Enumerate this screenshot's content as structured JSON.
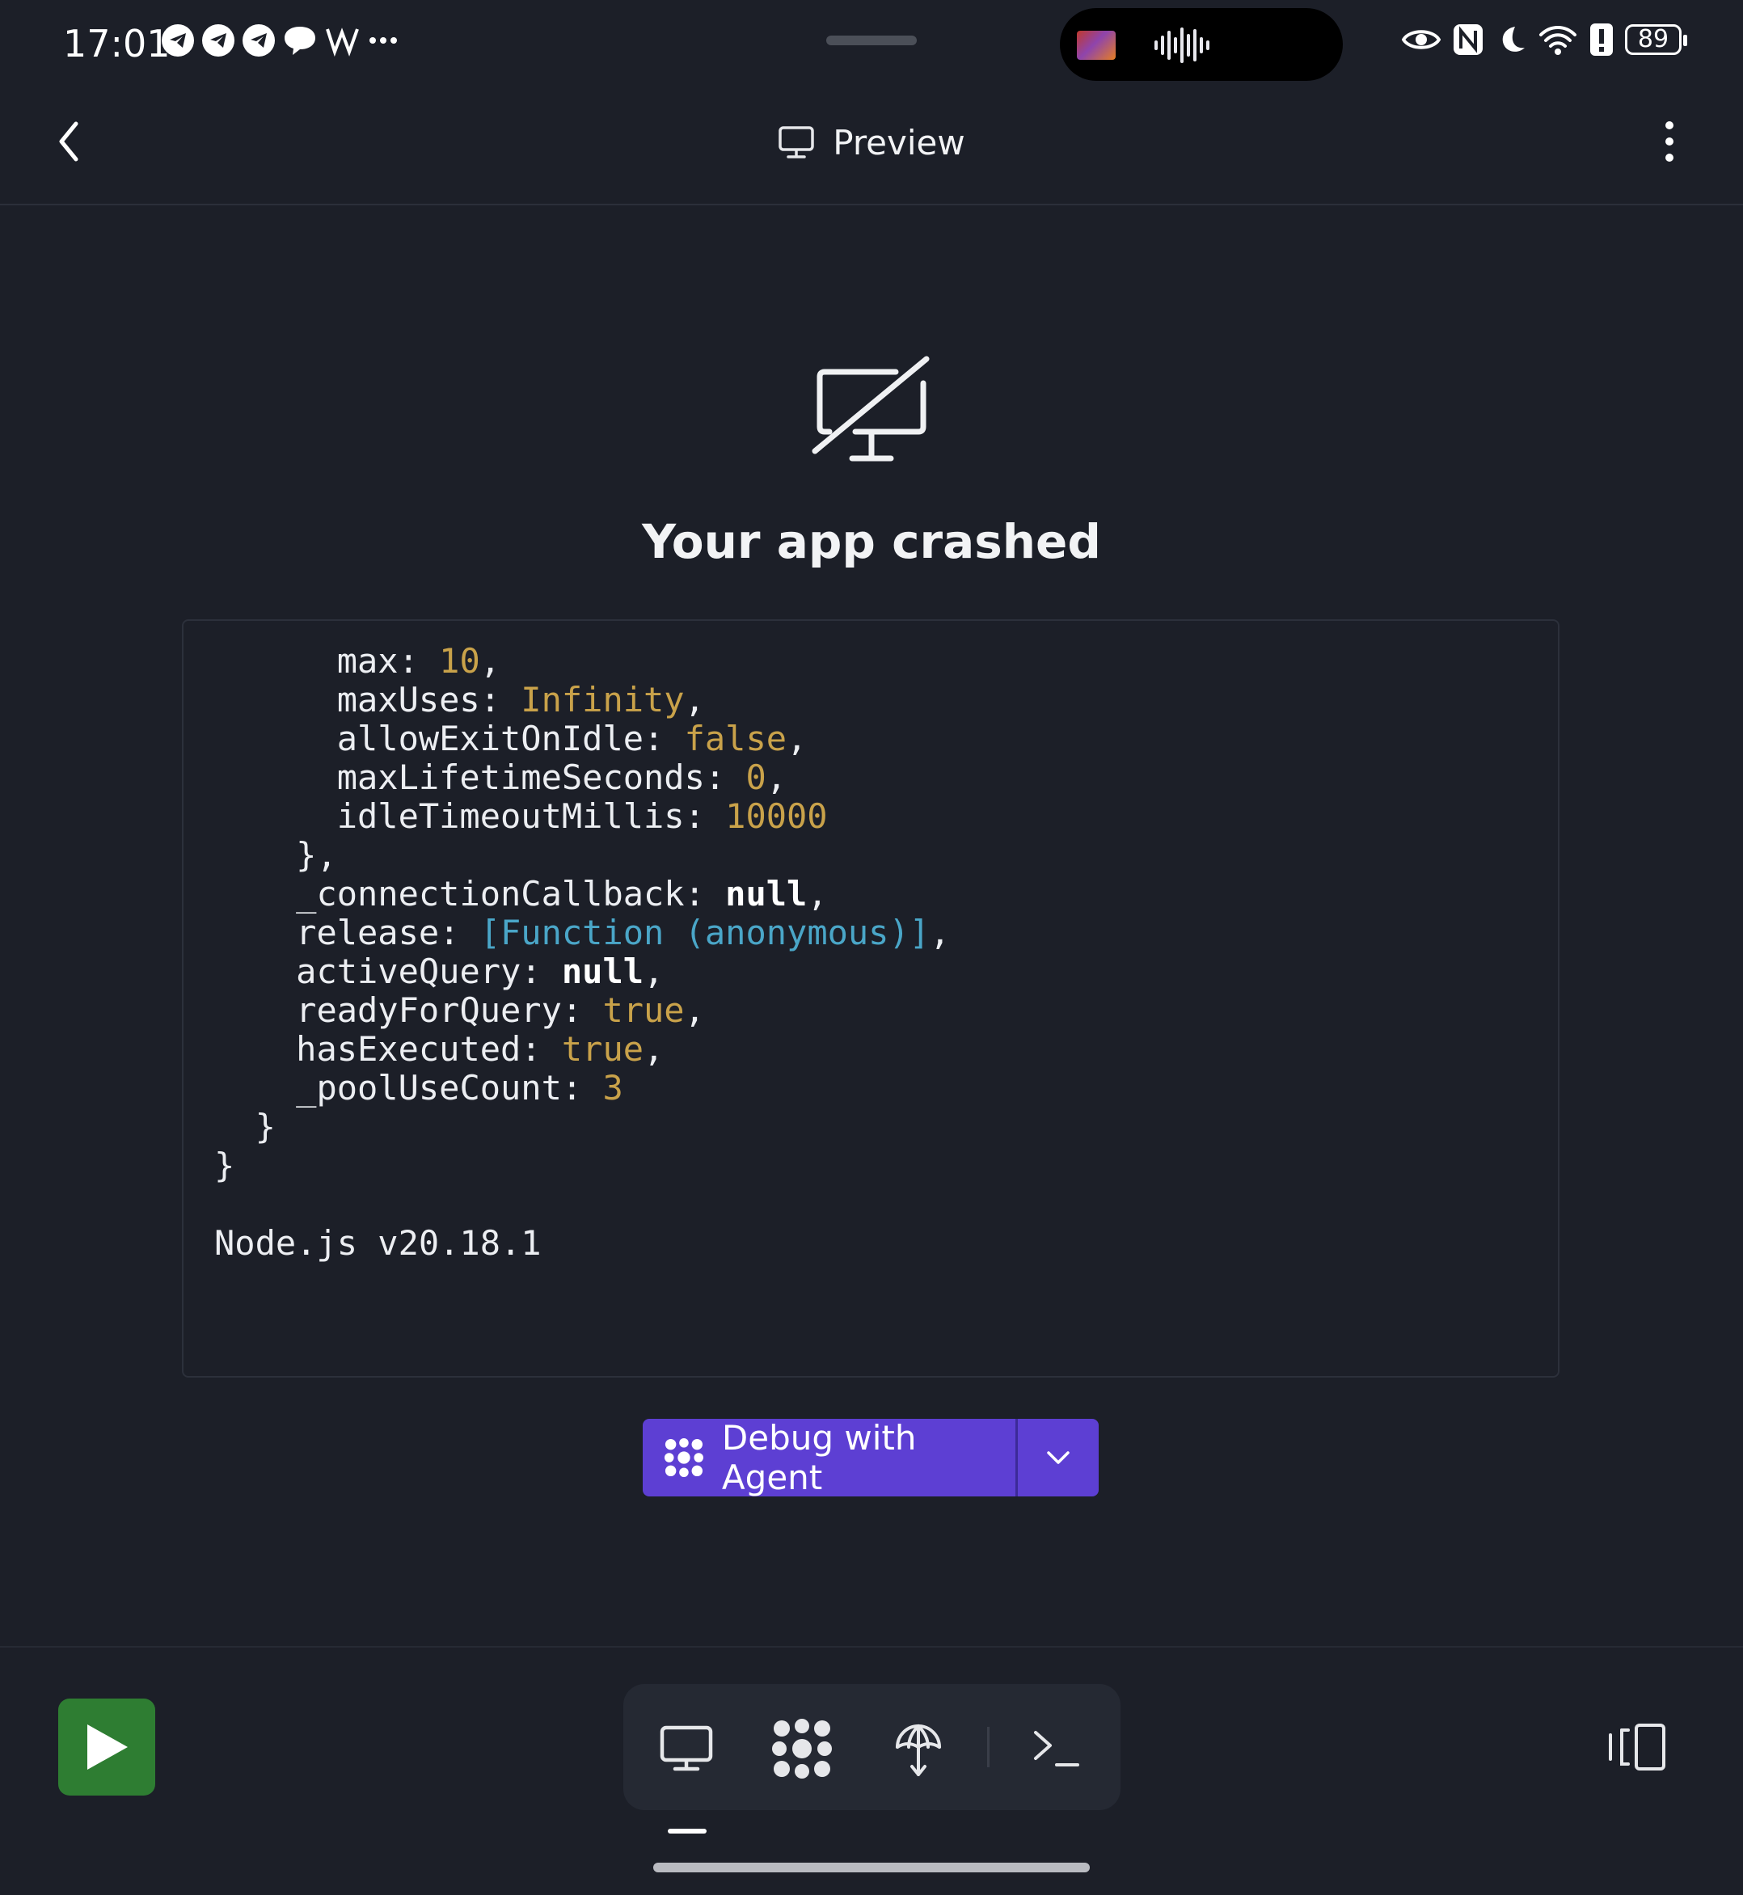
{
  "status_bar": {
    "time": "17:01",
    "notification_icons": [
      "telegram-icon",
      "telegram-icon",
      "telegram-icon",
      "chat-bubble-icon",
      "w-app-icon",
      "more-dots-icon"
    ],
    "battery": "89",
    "right_icons": [
      "eye-icon",
      "nfc-icon",
      "moon-icon",
      "wifi-icon",
      "alert-icon",
      "battery-icon"
    ]
  },
  "header": {
    "title": "Preview",
    "title_icon": "monitor-icon"
  },
  "crash": {
    "icon": "monitor-off-icon",
    "title": "Your app crashed",
    "log": {
      "max_key": "max: ",
      "max_val": "10",
      "maxUses_key": "maxUses: ",
      "maxUses_val": "Infinity",
      "allowExitOnIdle_key": "allowExitOnIdle: ",
      "allowExitOnIdle_val": "false",
      "maxLifetimeSeconds_key": "maxLifetimeSeconds: ",
      "maxLifetimeSeconds_val": "0",
      "idleTimeoutMillis_key": "idleTimeoutMillis: ",
      "idleTimeoutMillis_val": "10000",
      "close_inner": "},",
      "connectionCallback_key": "_connectionCallback: ",
      "connectionCallback_val": "null",
      "release_key": "release: ",
      "release_val": "[Function (anonymous)]",
      "activeQuery_key": "activeQuery: ",
      "activeQuery_val": "null",
      "readyForQuery_key": "readyForQuery: ",
      "readyForQuery_val": "true",
      "hasExecuted_key": "hasExecuted: ",
      "hasExecuted_val": "true",
      "poolUseCount_key": "_poolUseCount: ",
      "poolUseCount_val": "3",
      "close_1": "}",
      "close_2": "}",
      "node_version": "Node.js v20.18.1"
    }
  },
  "actions": {
    "debug_label": "Debug with Agent"
  },
  "bottom_bar": {
    "tools": [
      "preview-tool-icon",
      "agent-tool-icon",
      "deploy-tool-icon",
      "shell-tool-icon"
    ]
  },
  "colors": {
    "background": "#1c1f28",
    "accent": "#5d3fd3",
    "run_green": "#2e7d32",
    "number_color": "#c9a24a",
    "function_color": "#4aa6c8"
  }
}
